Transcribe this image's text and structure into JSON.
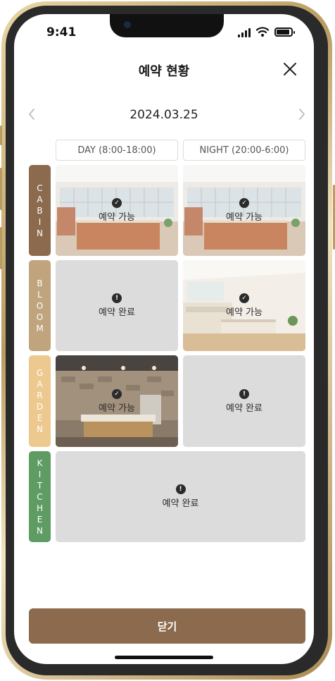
{
  "status_bar": {
    "time": "9:41"
  },
  "header": {
    "title": "예약 현황"
  },
  "date_nav": {
    "date": "2024.03.25"
  },
  "columns": [
    {
      "label": "DAY (8:00-18:00)"
    },
    {
      "label": "NIGHT (20:00-6:00)"
    }
  ],
  "rooms": [
    {
      "name": "CABIN",
      "letters": [
        "C",
        "A",
        "B",
        "I",
        "N"
      ],
      "color": "#8b6a4e",
      "slots": [
        {
          "status": "예약 가능",
          "available": true
        },
        {
          "status": "예약 가능",
          "available": true
        }
      ]
    },
    {
      "name": "BLOOM",
      "letters": [
        "B",
        "L",
        "O",
        "O",
        "M"
      ],
      "color": "#bfa47e",
      "slots": [
        {
          "status": "예약 완료",
          "available": false
        },
        {
          "status": "예약 가능",
          "available": true
        }
      ]
    },
    {
      "name": "GARDEN",
      "letters": [
        "G",
        "A",
        "R",
        "D",
        "E",
        "N"
      ],
      "color": "#edc98f",
      "slots": [
        {
          "status": "예약 가능",
          "available": true
        },
        {
          "status": "예약 완료",
          "available": false
        }
      ]
    },
    {
      "name": "KITCHEN",
      "letters": [
        "K",
        "I",
        "T",
        "C",
        "H",
        "E",
        "N"
      ],
      "color": "#5e9c63",
      "slots": [
        {
          "status": "예약 완료",
          "available": false
        }
      ]
    }
  ],
  "footer": {
    "button_label": "닫기"
  },
  "icons": {
    "close": "close-icon",
    "prev": "chevron-left-icon",
    "next": "chevron-right-icon",
    "available": "check-circle-icon",
    "booked": "exclamation-circle-icon"
  },
  "colors": {
    "accent": "#8b6a4e",
    "booked_bg": "#dcdcdc"
  }
}
